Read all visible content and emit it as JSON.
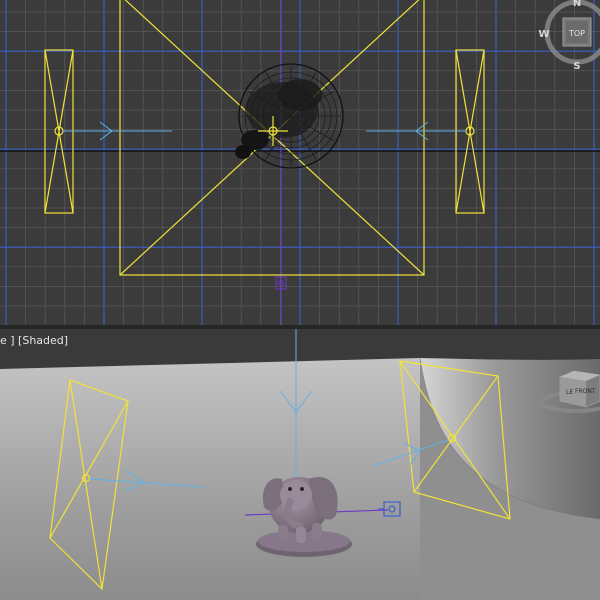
{
  "viewports": {
    "top": {
      "viewcube": {
        "face": "TOP",
        "compass_n": "N",
        "compass_s": "S",
        "compass_w": "W"
      }
    },
    "perspective": {
      "label": "e ] [Shaded]",
      "viewcube": {
        "face_left": "LE",
        "face_front": "FRONT"
      }
    }
  },
  "colors": {
    "grid_minor": "#5a5a5a",
    "grid_major": "#3b62c9",
    "light_gizmo": "#f0e23a",
    "axis_blue": "#5fb2e6",
    "axis_purple": "#6a3cc4",
    "elephant": "#8a7c8a"
  },
  "icons": [
    "compass-ring-icon",
    "viewcube-top-icon",
    "viewcube-perspective-icon",
    "light-target-icon"
  ]
}
